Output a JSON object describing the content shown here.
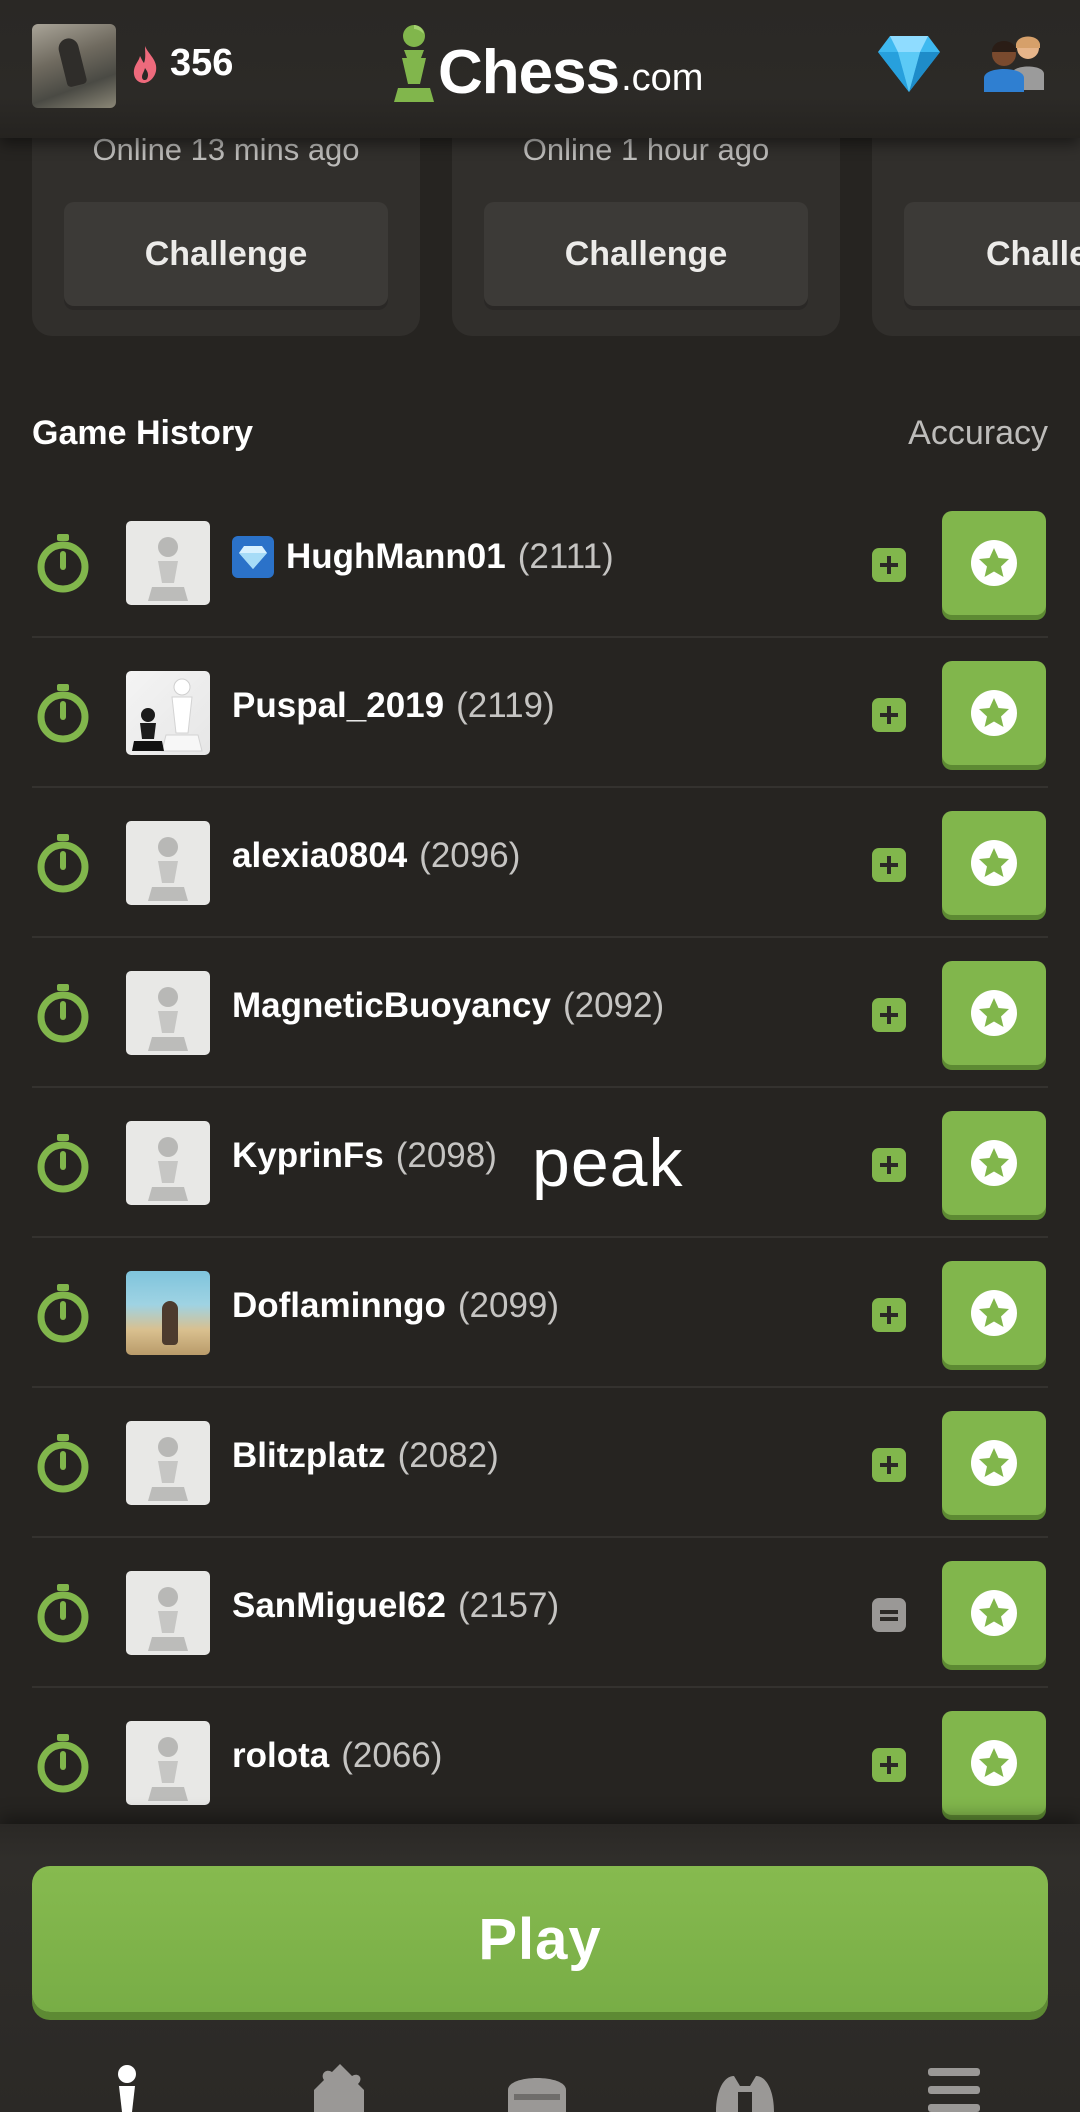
{
  "header": {
    "streak_count": "356",
    "logo_text": "Chess",
    "logo_suffix": ".com"
  },
  "friends": [
    {
      "status": "Online 13 mins ago",
      "action": "Challenge"
    },
    {
      "status": "Online 1 hour ago",
      "action": "Challenge"
    },
    {
      "status": "",
      "action": "Challenge"
    }
  ],
  "game_history": {
    "title": "Game History",
    "accuracy_label": "Accuracy",
    "games": [
      {
        "name": "HughMann01",
        "rating": "(2111)",
        "result": "win",
        "diamond": true
      },
      {
        "name": "Puspal_2019",
        "rating": "(2119)",
        "result": "win",
        "diamond": false
      },
      {
        "name": "alexia0804",
        "rating": "(2096)",
        "result": "win",
        "diamond": false
      },
      {
        "name": "MagneticBuoyancy",
        "rating": "(2092)",
        "result": "win",
        "diamond": false
      },
      {
        "name": "KyprinFs",
        "rating": "(2098)",
        "result": "win",
        "diamond": false
      },
      {
        "name": "Doflaminngo",
        "rating": "(2099)",
        "result": "win",
        "diamond": false
      },
      {
        "name": "Blitzplatz",
        "rating": "(2082)",
        "result": "win",
        "diamond": false
      },
      {
        "name": "SanMiguel62",
        "rating": "(2157)",
        "result": "draw",
        "diamond": false
      },
      {
        "name": "rolota",
        "rating": "(2066)",
        "result": "win",
        "diamond": false
      }
    ]
  },
  "watermark": "peak",
  "play_button": "Play",
  "nav": [
    "home-icon",
    "puzzle-icon",
    "learn-icon",
    "watch-icon",
    "more-icon"
  ],
  "colors": {
    "accent_green": "#81b64c",
    "background": "#262421",
    "card": "#312f2c",
    "premium_blue": "#2b72c9"
  }
}
